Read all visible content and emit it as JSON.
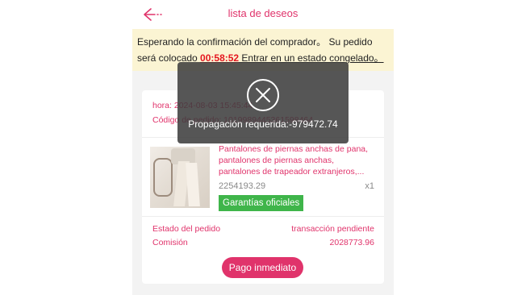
{
  "header": {
    "title": "lista de deseos",
    "back_icon": "arrow-left-icon"
  },
  "notice": {
    "text_1": "Esperando la confirmación del comprador。 Su pedido será colocado ",
    "timer": "00:58:52",
    "text_2": " Entrar en un estado congelado。"
  },
  "order": {
    "time_label": "hora: 2024-08-03 15:45:44",
    "code_label": "Código de pedido: 1019989445361598464",
    "product": {
      "name": "Pantalones de piernas anchas de pana, pantalones de piernas anchas, pantalones de trapeador extranjeros,...",
      "price": "2254193.29",
      "quantity": "x1",
      "badge": "Garantías oficiales"
    },
    "status_label": "Estado del pedido",
    "status_value": "transacción pendiente",
    "commission_label": "Comisión",
    "commission_value": "2028773.96",
    "pay_button": "Pago inmediato"
  },
  "toast": {
    "icon": "close-circle-icon",
    "message": "Propagación requerida:-979472.74"
  },
  "colors": {
    "accent": "#e0336b",
    "notice_bg": "#fbf4d3",
    "timer": "#e5161f",
    "badge": "#3fb54a",
    "toast_bg": "#3a3a3a"
  }
}
